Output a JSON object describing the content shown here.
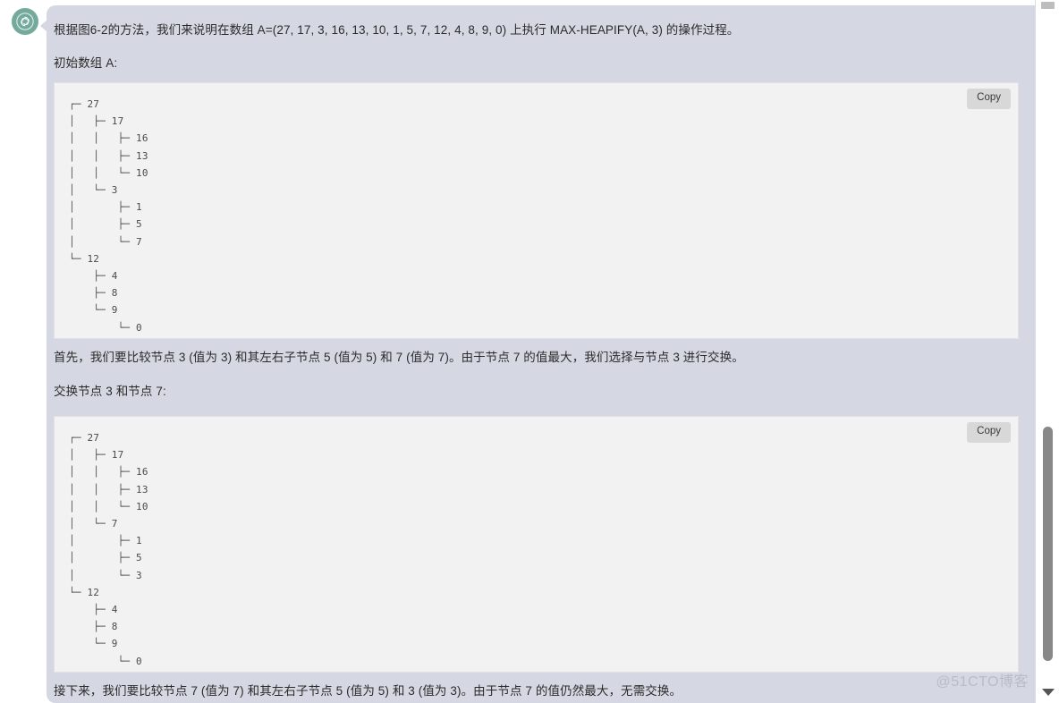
{
  "window": {
    "accent_color": "#6a0f1e",
    "background": "#ffffff"
  },
  "assistant": {
    "avatar_name": "openai-logo",
    "avatar_color": "#74aa9c"
  },
  "message": {
    "bubble_color": "#d5d8e2",
    "paragraphs": {
      "intro": "根据图6-2的方法，我们来说明在数组 A=(27, 17, 3, 16, 13, 10, 1, 5, 7, 12, 4, 8, 9, 0) 上执行 MAX-HEAPIFY(A, 3) 的操作过程。",
      "label_initial_array": "初始数组 A:",
      "compare_first": "首先，我们要比较节点 3 (值为 3) 和其左右子节点 5 (值为 5) 和 7 (值为 7)。由于节点 7 的值最大，我们选择与节点 3 进行交换。",
      "label_swap": "交换节点 3 和节点 7:",
      "compare_second": "接下来，我们要比较节点 7 (值为 7) 和其左右子节点 5 (值为 5) 和 3 (值为 3)。由于节点 7 的值仍然最大，无需交换。"
    }
  },
  "code_blocks": [
    {
      "id": "initial-array-tree",
      "copy_label": "Copy",
      "background": "#f2f2f2",
      "content": "┌─ 27\n│   ├─ 17\n│   │   ├─ 16\n│   │   ├─ 13\n│   │   └─ 10\n│   └─ 3\n│       ├─ 1\n│       ├─ 5\n│       └─ 7\n└─ 12\n    ├─ 4\n    ├─ 8\n    └─ 9\n        └─ 0"
    },
    {
      "id": "after-swap-tree",
      "copy_label": "Copy",
      "background": "#f2f2f2",
      "content": "┌─ 27\n│   ├─ 17\n│   │   ├─ 16\n│   │   ├─ 13\n│   │   └─ 10\n│   └─ 7\n│       ├─ 1\n│       ├─ 5\n│       └─ 3\n└─ 12\n    ├─ 4\n    ├─ 8\n    └─ 9\n        └─ 0"
    }
  ],
  "scrollbar": {
    "up_arrow_icon": "chevron-up-icon",
    "down_arrow_icon": "chevron-down-icon",
    "thumb_color": "#888888"
  },
  "watermark": {
    "text": "@51CTO博客",
    "color": "#b9bcc6"
  }
}
